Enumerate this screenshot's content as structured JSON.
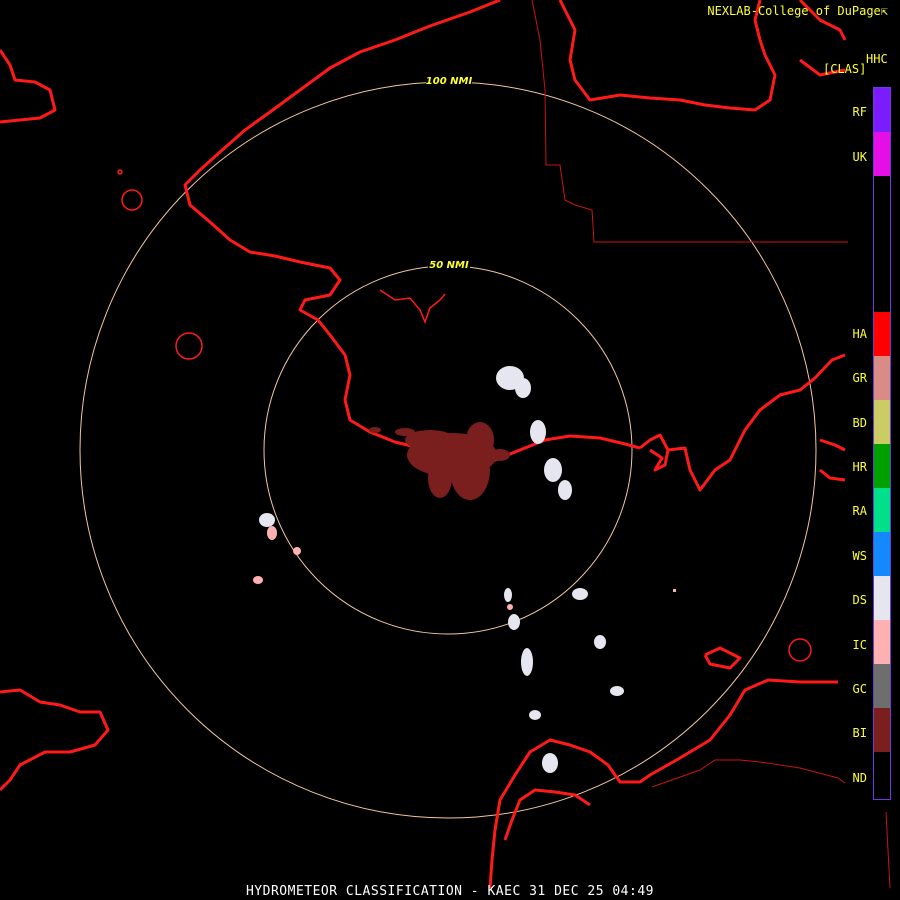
{
  "header": {
    "credit": "NEXLAB-College of DuPage",
    "credit_icon": "external-link-icon"
  },
  "product": {
    "code": "HHC",
    "unit": "[CLAS]"
  },
  "title": "HYDROMETEOR CLASSIFICATION - KAEC 31 DEC 25 04:49",
  "range_rings": [
    {
      "label": "100 NMI",
      "radius_nmi": 100
    },
    {
      "label": "50 NMI",
      "radius_nmi": 50
    }
  ],
  "legend": [
    {
      "code": "RF",
      "color": "#7b1cff"
    },
    {
      "code": "UK",
      "color": "#e60ee6"
    },
    {
      "code": "HA",
      "color": "#ff0000"
    },
    {
      "code": "GR",
      "color": "#d98b86"
    },
    {
      "code": "BD",
      "color": "#cccc66"
    },
    {
      "code": "HR",
      "color": "#00a000"
    },
    {
      "code": "RA",
      "color": "#00e08a"
    },
    {
      "code": "WS",
      "color": "#1488ff"
    },
    {
      "code": "DS",
      "color": "#e6e6f0"
    },
    {
      "code": "IC",
      "color": "#ffb0b0"
    },
    {
      "code": "GC",
      "color": "#6e6e6e"
    },
    {
      "code": "BI",
      "color": "#7a1e1e"
    },
    {
      "code": "ND",
      "color": "#000000"
    }
  ],
  "colors": {
    "coastline": "#ff1a1a",
    "range_ring": "#f2c6a0",
    "label_text": "#ffff33"
  }
}
